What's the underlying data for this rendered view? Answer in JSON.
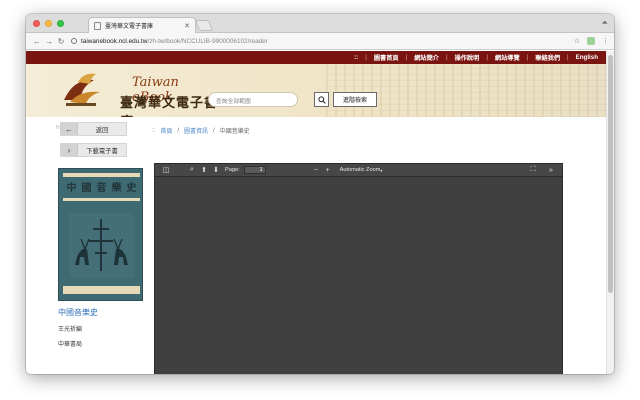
{
  "browser": {
    "tab_title": "臺灣華文電子書庫",
    "url_host": "taiwanebook.ncl.edu.tw",
    "url_path": "/zh-tw/book/NCCULIB-9900006102/reader"
  },
  "topnav": {
    "items": [
      {
        "label": "::"
      },
      {
        "label": "圖書首頁"
      },
      {
        "label": "網站簡介"
      },
      {
        "label": "操作說明"
      },
      {
        "label": "網站導覽"
      },
      {
        "label": "聯絡我們"
      },
      {
        "label": "English"
      }
    ],
    "separator": "|"
  },
  "header": {
    "logo_en": "Taiwan eBook",
    "logo_zh": "臺灣華文電子書庫",
    "search_placeholder": "查詢全部範圍",
    "advanced_search_label": "進階檢索"
  },
  "sidebar": {
    "back_label": "返回",
    "download_label": "下載電子書",
    "gutter_marker": "H"
  },
  "breadcrumb": {
    "marker": "::",
    "items": [
      "首頁",
      "圖書資訊",
      "中國音樂史"
    ],
    "separator": "/"
  },
  "book": {
    "cover_title": "中國音樂史",
    "title": "中國音樂史",
    "author": "王光祈編",
    "publisher": "中華書局"
  },
  "viewer": {
    "page_label": "Page:",
    "page_value": "1",
    "zoom_label": "Automatic Zoom"
  },
  "colors": {
    "nav_bar": "#7a1410",
    "link": "#2e71b8",
    "viewer_bg": "#404040"
  }
}
